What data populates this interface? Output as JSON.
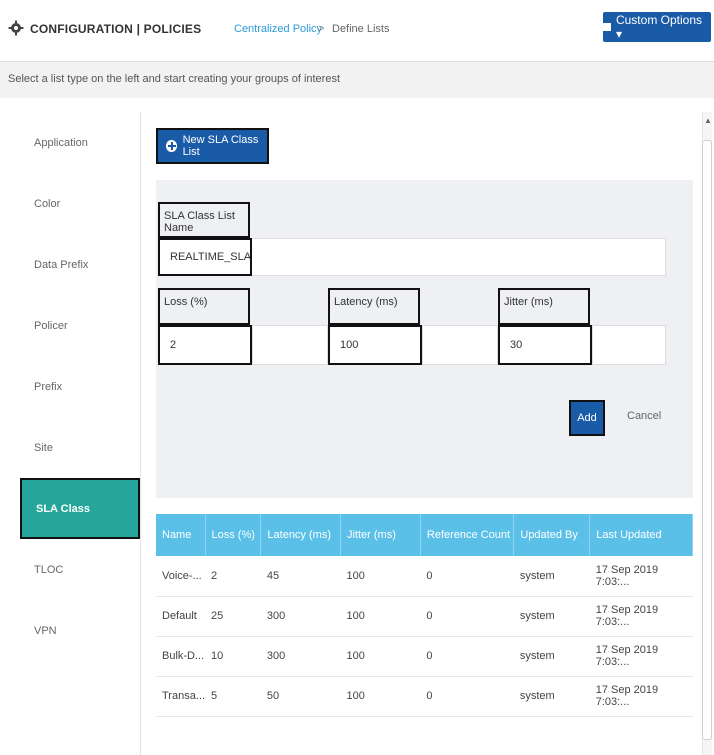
{
  "header": {
    "title": "CONFIGURATION | POLICIES",
    "breadcrumb_link": "Centralized Policy",
    "breadcrumb_sep": ">",
    "breadcrumb_current": "Define Lists",
    "custom_options": "Custom Options ▾"
  },
  "instruction": "Select a list type on the left and start creating your groups of interest",
  "sidebar": {
    "items": [
      {
        "label": "Application"
      },
      {
        "label": "Color"
      },
      {
        "label": "Data Prefix"
      },
      {
        "label": "Policer"
      },
      {
        "label": "Prefix"
      },
      {
        "label": "Site"
      },
      {
        "label": "SLA Class"
      },
      {
        "label": "TLOC"
      },
      {
        "label": "VPN"
      }
    ],
    "active": "SLA Class"
  },
  "main": {
    "new_button": "New SLA Class List",
    "form": {
      "name_label": "SLA Class List Name",
      "name_value": "REALTIME_SLA",
      "loss_label": "Loss (%)",
      "loss_value": "2",
      "latency_label": "Latency (ms)",
      "latency_value": "100",
      "jitter_label": "Jitter (ms)",
      "jitter_value": "30",
      "add": "Add",
      "cancel": "Cancel"
    },
    "table": {
      "headers": [
        "Name",
        "Loss (%)",
        "Latency (ms)",
        "Jitter (ms)",
        "Reference Count",
        "Updated By",
        "Last Updated"
      ],
      "rows": [
        [
          "Voice-...",
          "2",
          "45",
          "100",
          "0",
          "system",
          "17 Sep 2019 7:03:..."
        ],
        [
          "Default",
          "25",
          "300",
          "100",
          "0",
          "system",
          "17 Sep 2019 7:03:..."
        ],
        [
          "Bulk-D...",
          "10",
          "300",
          "100",
          "0",
          "system",
          "17 Sep 2019 7:03:..."
        ],
        [
          "Transa...",
          "5",
          "50",
          "100",
          "0",
          "system",
          "17 Sep 2019 7:03:..."
        ]
      ]
    }
  },
  "colors": {
    "primary": "#1a5ba8",
    "table_header": "#5bc0e8",
    "active_side": "#26a69a",
    "link": "#2a9bd6"
  }
}
